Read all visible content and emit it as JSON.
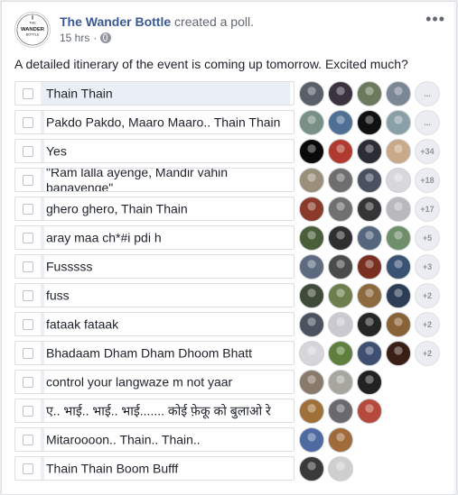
{
  "post": {
    "page_name": "The Wander Bottle",
    "action": "created a poll.",
    "time": "15 hrs",
    "more_label": "•••",
    "logo_text": [
      "THE",
      "WANDER",
      "BOTTLE"
    ]
  },
  "poll": {
    "question": "A detailed itinerary of the event is coming up tomorrow. Excited much?",
    "options": [
      {
        "label": "Thain Thain",
        "more": "...",
        "voters": [
          "#5a5f6a",
          "#3b3440",
          "#6b7a5c",
          "#7c8796"
        ]
      },
      {
        "label": "Pakdo Pakdo, Maaro Maaro.. Thain Thain",
        "more": "...",
        "voters": [
          "#7a8f86",
          "#4f6f95",
          "#111111",
          "#8aa0a8"
        ]
      },
      {
        "label": "Yes",
        "more": "+34",
        "voters": [
          "#0a0a0a",
          "#b03a2e",
          "#2c2c35",
          "#c9a98a"
        ]
      },
      {
        "label": "\"Ram lalla ayenge, Mandir vahin banayenge\"",
        "more": "+18",
        "voters": [
          "#9c8f7a",
          "#6e6e6e",
          "#4a5262",
          "#d8d8dc"
        ]
      },
      {
        "label": "ghero ghero, Thain Thain",
        "more": "+17",
        "voters": [
          "#8b3a2a",
          "#707070",
          "#353535",
          "#b9b9bd"
        ]
      },
      {
        "label": "aray maa ch*#i pdi h",
        "more": "+5",
        "voters": [
          "#4a5e3a",
          "#2f2f2f",
          "#56677d",
          "#6f8e6a"
        ]
      },
      {
        "label": "Fusssss",
        "more": "+3",
        "voters": [
          "#5c6b7f",
          "#4b4b4b",
          "#7a3020",
          "#3a5274"
        ]
      },
      {
        "label": "fuss",
        "more": "+2",
        "voters": [
          "#3f4a38",
          "#6d7f4c",
          "#8c6a3e",
          "#2d3d55"
        ]
      },
      {
        "label": "fataak fataak",
        "more": "+2",
        "voters": [
          "#4c5360",
          "#c9c9cf",
          "#262626",
          "#8a6238"
        ]
      },
      {
        "label": "Bhadaam Dham Dham Dhoom Bhatt",
        "more": "+2",
        "voters": [
          "#d6d6da",
          "#5e7f3e",
          "#3e4f72",
          "#3a1f16"
        ]
      },
      {
        "label": "control your langwaze m not yaar",
        "more": "",
        "voters": [
          "#8a7a6a",
          "#a7a7a0",
          "#222222"
        ]
      },
      {
        "label": "ए.. भाई.. भाई.. भाई....... कोई फ़ेकू को बुलाओ रे",
        "more": "",
        "voters": [
          "#a0703a",
          "#6a6a6e",
          "#b54a3c"
        ]
      },
      {
        "label": "Mitaroooon.. Thain.. Thain..",
        "more": "",
        "voters": [
          "#4f6aa0",
          "#a06a3a"
        ]
      },
      {
        "label": "Thain Thain Boom Bufff",
        "more": "",
        "voters": [
          "#3a3a3a",
          "#cfcfcf"
        ]
      }
    ]
  }
}
